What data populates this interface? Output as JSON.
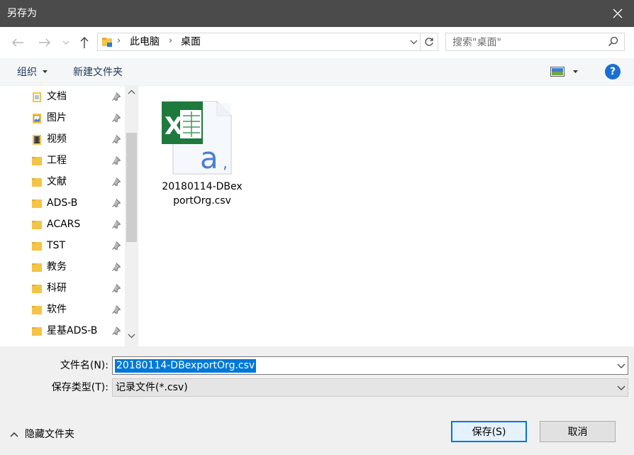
{
  "window": {
    "title": "另存为"
  },
  "address": {
    "crumbs": [
      "此电脑",
      "桌面"
    ]
  },
  "search": {
    "placeholder": "搜索\"桌面\""
  },
  "toolbar": {
    "organize": "组织",
    "new_folder": "新建文件夹",
    "help": "?"
  },
  "nav_items": [
    {
      "label": "文档",
      "icon": "documents-folder-icon"
    },
    {
      "label": "图片",
      "icon": "pictures-folder-icon"
    },
    {
      "label": "视频",
      "icon": "videos-folder-icon"
    },
    {
      "label": "工程",
      "icon": "folder-icon"
    },
    {
      "label": "文献",
      "icon": "folder-icon"
    },
    {
      "label": "ADS-B",
      "icon": "folder-icon"
    },
    {
      "label": "ACARS",
      "icon": "folder-icon"
    },
    {
      "label": "TST",
      "icon": "folder-icon"
    },
    {
      "label": "教务",
      "icon": "folder-icon"
    },
    {
      "label": "科研",
      "icon": "folder-icon"
    },
    {
      "label": "软件",
      "icon": "folder-icon"
    },
    {
      "label": "星基ADS-B",
      "icon": "folder-icon"
    }
  ],
  "files": [
    {
      "name_line1": "20180114-DBex",
      "name_line2": "portOrg.csv",
      "icon": "excel-csv-file-icon"
    }
  ],
  "form": {
    "filename_label": "文件名(N):",
    "filename_value": "20180114-DBexportOrg.csv",
    "filetype_label": "保存类型(T):",
    "filetype_value": "记录文件(*.csv)"
  },
  "footer": {
    "hide_folders": "隐藏文件夹",
    "save": "保存(S)",
    "cancel": "取消"
  },
  "colors": {
    "titlebar": "#4b4b4b",
    "selection": "#0078d7",
    "folder": "#f4c446",
    "panel": "#f0f0f0"
  }
}
